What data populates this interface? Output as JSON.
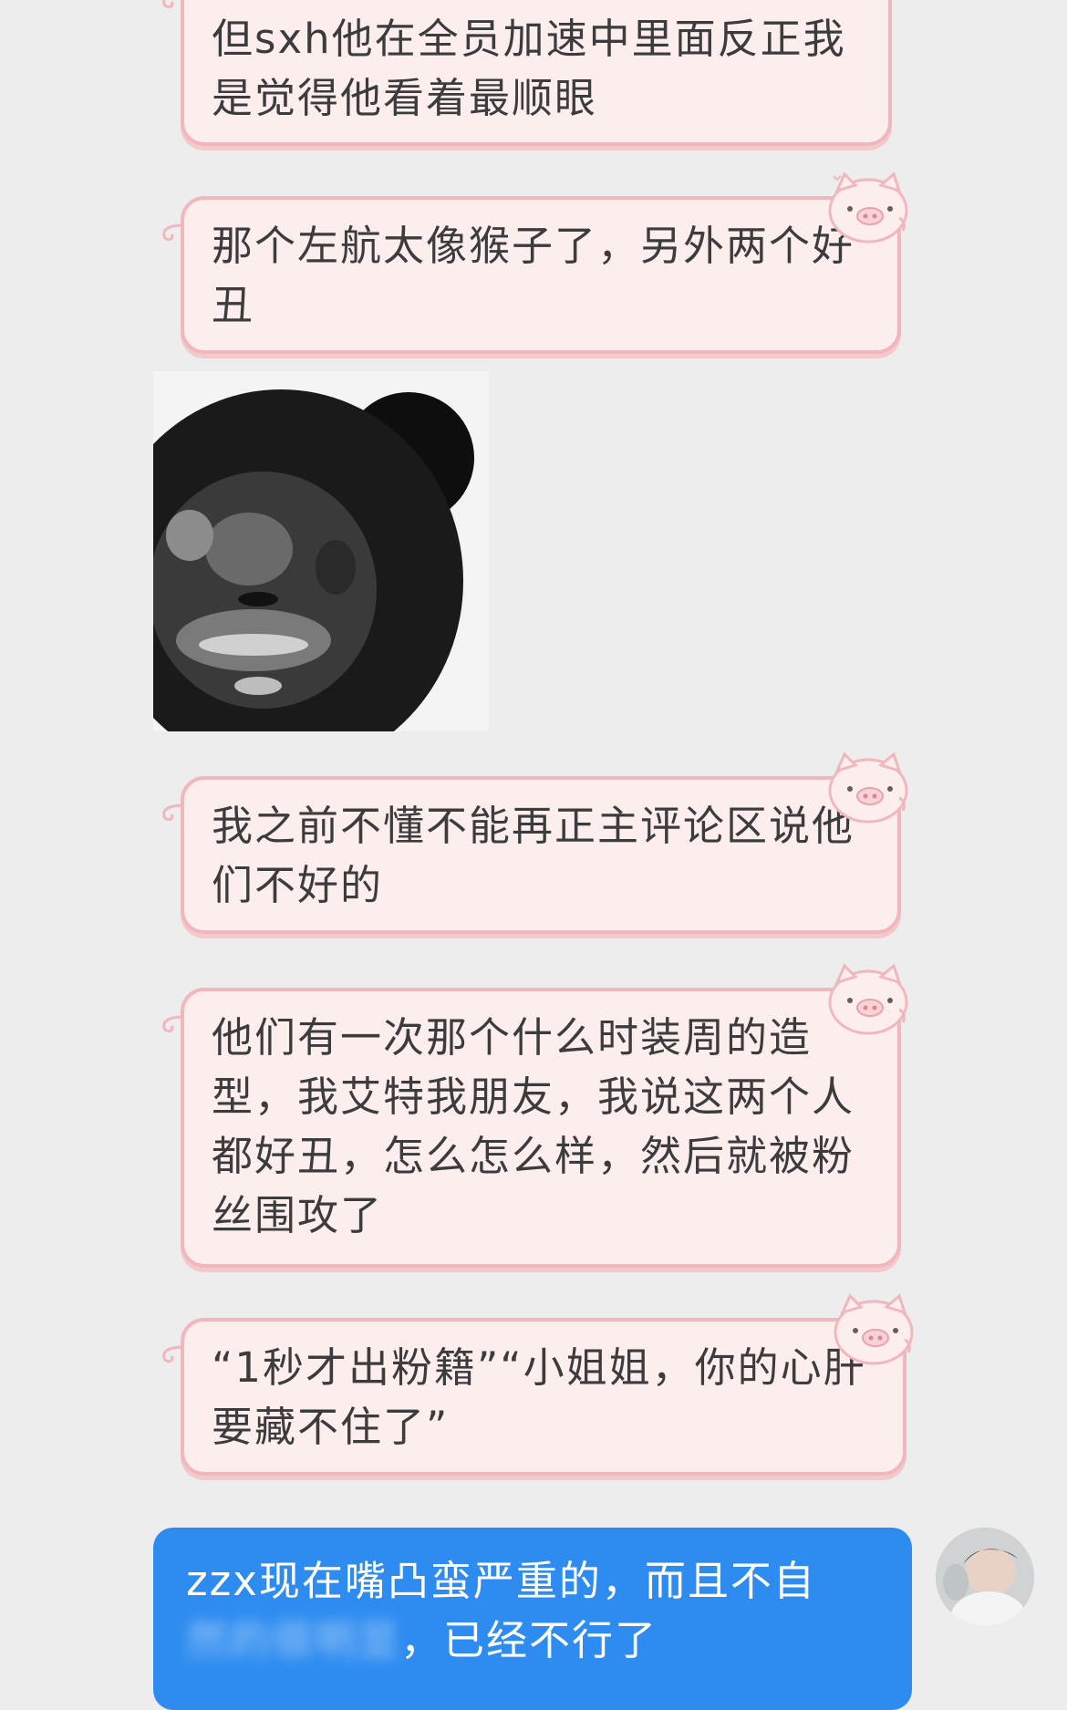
{
  "messages": [
    {
      "side": "left",
      "text": "但sxh他在全员加速中里面反正我是觉得他看着最顺眼"
    },
    {
      "side": "left",
      "text": "那个左航太像猴子了，另外两个好丑"
    },
    {
      "side": "left",
      "type": "image",
      "icon": "panda-meme-sticker"
    },
    {
      "side": "left",
      "text": "我之前不懂不能再正主评论区说他们不好的"
    },
    {
      "side": "left",
      "text": "他们有一次那个什么时装周的造型，我艾特我朋友，我说这两个人都好丑，怎么怎么样，然后就被粉丝围攻了"
    },
    {
      "side": "left",
      "text": "“1秒才出粉籍”“小姐姐，你的心肝要藏不住了”"
    },
    {
      "side": "right",
      "text_visible": "zzx现在嘴凸蛮严重的，而且不自",
      "text_blurred": "然的很明显",
      "text_end": "，已经不行了"
    }
  ],
  "colors": {
    "background": "#ededed",
    "left_bubble_fill": "#fdeeee",
    "left_bubble_border": "#f0b8bd",
    "right_bubble_fill": "#2e8cf0",
    "text": "#3c3c3c"
  },
  "icons": {
    "bubble_decoration": "pig-face-icon",
    "avatar": "user-avatar"
  }
}
